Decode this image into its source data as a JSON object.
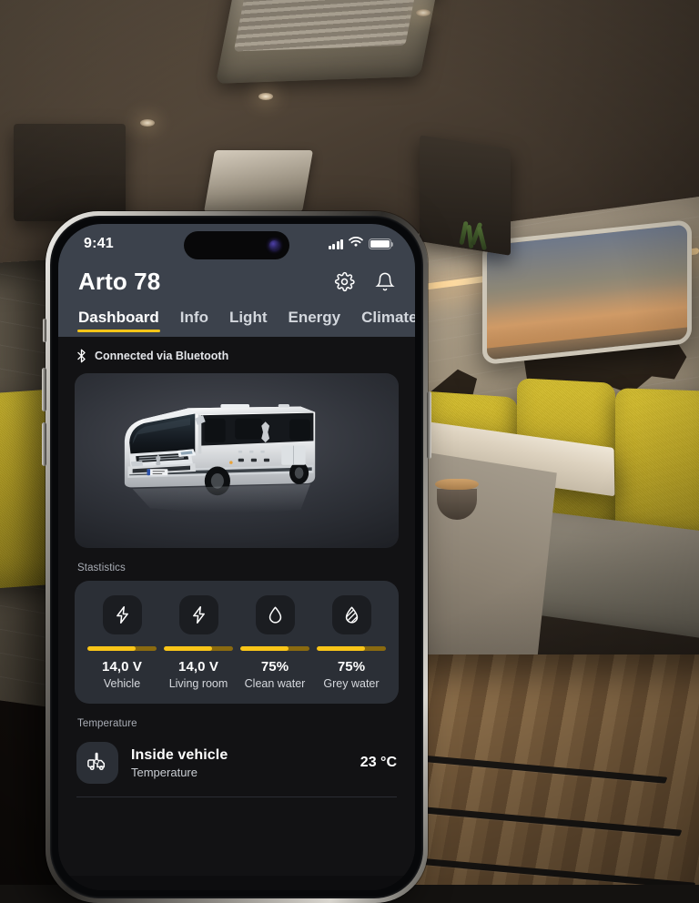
{
  "statusbar": {
    "time": "9:41",
    "icons": {
      "signal": "cellular-signal-icon",
      "wifi": "wifi-icon",
      "battery": "battery-full-icon"
    }
  },
  "header": {
    "title": "Arto 78",
    "settings_icon": "gear-icon",
    "notifications_icon": "bell-icon"
  },
  "tabs": [
    {
      "label": "Dashboard",
      "active": true
    },
    {
      "label": "Info",
      "active": false
    },
    {
      "label": "Light",
      "active": false
    },
    {
      "label": "Energy",
      "active": false
    },
    {
      "label": "Climate",
      "active": false
    }
  ],
  "connection": {
    "icon": "bluetooth-icon",
    "text": "Connected via Bluetooth"
  },
  "hero": {
    "alt": "motorhome-vehicle-render"
  },
  "statistics": {
    "section_label": "Stastistics",
    "items": [
      {
        "icon": "bolt-icon",
        "value": "14,0 V",
        "label": "Vehicle",
        "fill": 70
      },
      {
        "icon": "bolt-icon",
        "value": "14,0 V",
        "label": "Living room",
        "fill": 70
      },
      {
        "icon": "droplet-icon",
        "value": "75%",
        "label": "Clean water",
        "fill": 70
      },
      {
        "icon": "droplet-grey-icon",
        "value": "75%",
        "label": "Grey water",
        "fill": 70
      }
    ]
  },
  "temperature": {
    "section_label": "Temperature",
    "row": {
      "icon": "vehicle-thermometer-icon",
      "title": "Inside vehicle",
      "subtitle": "Temperature",
      "value": "23 °C"
    }
  },
  "colors": {
    "accent": "#f5c518",
    "header_bg": "#3c424c",
    "screen_bg": "#121214",
    "card_bg": "#2b2f36"
  }
}
